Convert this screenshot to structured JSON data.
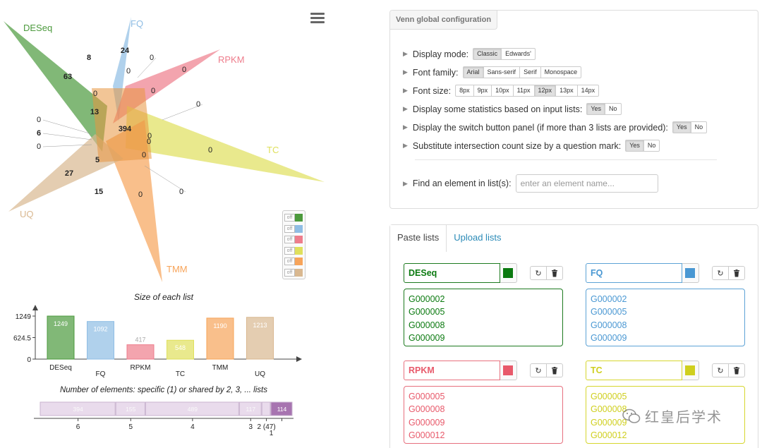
{
  "venn": {
    "lists": [
      {
        "name": "DESeq",
        "color": "#4c9a3d"
      },
      {
        "name": "FQ",
        "color": "#8fbde4"
      },
      {
        "name": "RPKM",
        "color": "#ee7d8c"
      },
      {
        "name": "TC",
        "color": "#dfe05c"
      },
      {
        "name": "TMM",
        "color": "#f7a45a"
      },
      {
        "name": "UQ",
        "color": "#d9b890"
      }
    ],
    "counts": [
      {
        "text": "8",
        "bold": true
      },
      {
        "text": "24",
        "bold": true
      },
      {
        "text": "0",
        "bold": false
      },
      {
        "text": "63",
        "bold": true
      },
      {
        "text": "0",
        "bold": false
      },
      {
        "text": "0",
        "bold": false
      },
      {
        "text": "0",
        "bold": false
      },
      {
        "text": "0",
        "bold": false
      },
      {
        "text": "0",
        "bold": false
      },
      {
        "text": "13",
        "bold": true
      },
      {
        "text": "0",
        "bold": false
      },
      {
        "text": "6",
        "bold": true
      },
      {
        "text": "394",
        "bold": true
      },
      {
        "text": "0",
        "bold": false
      },
      {
        "text": "0",
        "bold": false
      },
      {
        "text": "0",
        "bold": false
      },
      {
        "text": "0",
        "bold": false
      },
      {
        "text": "5",
        "bold": true
      },
      {
        "text": "0",
        "bold": false
      },
      {
        "text": "27",
        "bold": true
      },
      {
        "text": "15",
        "bold": true
      },
      {
        "text": "0",
        "bold": false
      },
      {
        "text": "0",
        "bold": false
      }
    ],
    "switch_label": "off"
  },
  "chart_data": [
    {
      "type": "bar",
      "title": "Size of each list",
      "categories": [
        "DESeq",
        "FQ",
        "RPKM",
        "TC",
        "TMM",
        "UQ"
      ],
      "values": [
        1249,
        1092,
        417,
        548,
        1190,
        1213
      ],
      "colors": [
        "#4c9a3d",
        "#8fbde4",
        "#ee7d8c",
        "#dfe05c",
        "#f7a45a",
        "#d9b890"
      ],
      "yticks": [
        "1249",
        "624.5",
        "0"
      ],
      "ylim": [
        0,
        1249
      ]
    },
    {
      "type": "bar",
      "title": "Number of elements: specific (1) or shared by 2, 3, ... lists",
      "categories": [
        "6",
        "5",
        "4",
        "3",
        "2 (47)",
        "1"
      ],
      "values": [
        394,
        155,
        489,
        117,
        47,
        114
      ],
      "labels": [
        "394",
        "155",
        "489",
        "117",
        "",
        "114"
      ]
    }
  ],
  "config": {
    "header": "Venn global configuration",
    "rows": [
      {
        "label": "Display mode:",
        "options": [
          "Classic",
          "Edwards'"
        ],
        "active": 0
      },
      {
        "label": "Font family:",
        "options": [
          "Arial",
          "Sans-serif",
          "Serif",
          "Monospace"
        ],
        "active": 0
      },
      {
        "label": "Font size:",
        "options": [
          "8px",
          "9px",
          "10px",
          "11px",
          "12px",
          "13px",
          "14px"
        ],
        "active": 4
      },
      {
        "label": "Display some statistics based on input lists:",
        "options": [
          "Yes",
          "No"
        ],
        "active": 0
      },
      {
        "label": "Display the switch button panel (if more than 3 lists are provided):",
        "options": [
          "Yes",
          "No"
        ],
        "active": 0
      },
      {
        "label": "Substitute intersection count size by a question mark:",
        "options": [
          "Yes",
          "No"
        ],
        "active": 0
      }
    ],
    "find_label": "Find an element in list(s):",
    "find_placeholder": "enter an element name..."
  },
  "lists_panel": {
    "tabs": [
      "Paste lists",
      "Upload lists"
    ],
    "lists": [
      {
        "name": "DESeq",
        "color": "#0b7a10",
        "border": "#1d7a1f",
        "items": [
          "G000002",
          "G000005",
          "G000008",
          "G000009"
        ]
      },
      {
        "name": "FQ",
        "color": "#4a98d3",
        "border": "#5da3d6",
        "items": [
          "G000002",
          "G000005",
          "G000008",
          "G000009"
        ]
      },
      {
        "name": "RPKM",
        "color": "#e85a6b",
        "border": "#e7707e",
        "items": [
          "G000005",
          "G000008",
          "G000009",
          "G000012"
        ]
      },
      {
        "name": "TC",
        "color": "#cfcf1e",
        "border": "#d6d62e",
        "items": [
          "G000005",
          "G000008",
          "G000009",
          "G000012"
        ]
      }
    ]
  },
  "watermark": "红皇后学术"
}
